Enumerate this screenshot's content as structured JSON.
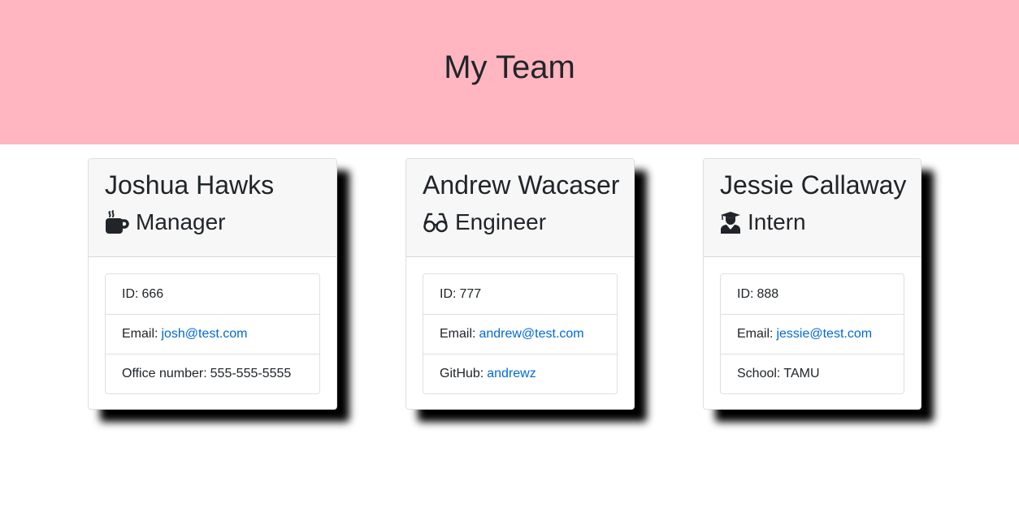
{
  "page": {
    "title": "My Team"
  },
  "team": [
    {
      "name": "Joshua Hawks",
      "role": "Manager",
      "role_icon": "mug-hot-icon",
      "id_label": "ID:",
      "id": "666",
      "email_label": "Email:",
      "email": "josh@test.com",
      "extra_label": "Office number:",
      "extra_value": "555-555-5555"
    },
    {
      "name": "Andrew Wacaser",
      "role": "Engineer",
      "role_icon": "glasses-icon",
      "id_label": "ID:",
      "id": "777",
      "email_label": "Email:",
      "email": "andrew@test.com",
      "extra_label": "GitHub:",
      "extra_value": "andrewz"
    },
    {
      "name": "Jessie Callaway",
      "role": "Intern",
      "role_icon": "user-graduate-icon",
      "id_label": "ID:",
      "id": "888",
      "email_label": "Email:",
      "email": "jessie@test.com",
      "extra_label": "School:",
      "extra_value": "TAMU"
    }
  ],
  "colors": {
    "header_bg": "#ffb6c1",
    "link": "#0069d9",
    "card_header_bg": "#f7f7f7",
    "shadow": "#000000"
  }
}
